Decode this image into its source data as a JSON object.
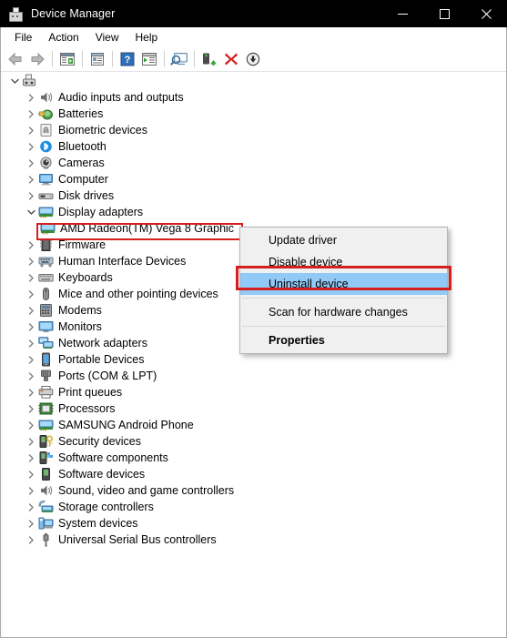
{
  "window": {
    "title": "Device Manager",
    "icon": "device-manager-icon",
    "controls": {
      "minimize": "minimize-icon",
      "maximize": "maximize-icon",
      "close": "close-icon"
    }
  },
  "menubar": {
    "items": [
      {
        "label": "File"
      },
      {
        "label": "Action"
      },
      {
        "label": "View"
      },
      {
        "label": "Help"
      }
    ]
  },
  "toolbar": {
    "buttons": [
      {
        "name": "back-button",
        "icon": "back-arrow-icon"
      },
      {
        "name": "forward-button",
        "icon": "forward-arrow-icon"
      },
      {
        "name": "separator-1",
        "icon": "separator"
      },
      {
        "name": "show-hide-console-tree-button",
        "icon": "console-tree-icon"
      },
      {
        "name": "separator-2",
        "icon": "separator"
      },
      {
        "name": "properties-button",
        "icon": "properties-window-icon"
      },
      {
        "name": "separator-3",
        "icon": "separator"
      },
      {
        "name": "help-button",
        "icon": "help-question-icon"
      },
      {
        "name": "action-button",
        "icon": "action-pane-icon"
      },
      {
        "name": "separator-4",
        "icon": "separator"
      },
      {
        "name": "scan-for-hardware-changes-button",
        "icon": "scan-monitor-icon"
      },
      {
        "name": "separator-5",
        "icon": "separator"
      },
      {
        "name": "update-driver-button",
        "icon": "update-driver-green-icon"
      },
      {
        "name": "uninstall-device-button",
        "icon": "red-x-icon"
      },
      {
        "name": "disable-device-button",
        "icon": "down-arrow-circle-icon"
      }
    ]
  },
  "tree": {
    "root": {
      "label": "",
      "icon": "computer-root-icon",
      "expanded": true
    },
    "nodes": [
      {
        "label": "Audio inputs and outputs",
        "icon": "speaker-icon",
        "expanded": false
      },
      {
        "label": "Batteries",
        "icon": "battery-icon",
        "expanded": false
      },
      {
        "label": "Biometric devices",
        "icon": "fingerprint-icon",
        "expanded": false
      },
      {
        "label": "Bluetooth",
        "icon": "bluetooth-icon",
        "expanded": false
      },
      {
        "label": "Cameras",
        "icon": "camera-icon",
        "expanded": false
      },
      {
        "label": "Computer",
        "icon": "computer-icon",
        "expanded": false
      },
      {
        "label": "Disk drives",
        "icon": "disk-drive-icon",
        "expanded": false
      },
      {
        "label": "Display adapters",
        "icon": "display-adapter-icon",
        "expanded": true
      },
      {
        "label": "AMD Radeon(TM) Vega 8 Graphic",
        "icon": "display-adapter-icon",
        "child": true,
        "selected": true
      },
      {
        "label": "Firmware",
        "icon": "firmware-chip-icon",
        "expanded": false
      },
      {
        "label": "Human Interface Devices",
        "icon": "hid-icon",
        "expanded": false
      },
      {
        "label": "Keyboards",
        "icon": "keyboard-icon",
        "expanded": false
      },
      {
        "label": "Mice and other pointing devices",
        "icon": "mouse-icon",
        "expanded": false
      },
      {
        "label": "Modems",
        "icon": "modem-icon",
        "expanded": false
      },
      {
        "label": "Monitors",
        "icon": "monitor-icon",
        "expanded": false
      },
      {
        "label": "Network adapters",
        "icon": "network-adapter-icon",
        "expanded": false
      },
      {
        "label": "Portable Devices",
        "icon": "portable-device-icon",
        "expanded": false
      },
      {
        "label": "Ports (COM & LPT)",
        "icon": "port-icon",
        "expanded": false
      },
      {
        "label": "Print queues",
        "icon": "printer-icon",
        "expanded": false
      },
      {
        "label": "Processors",
        "icon": "processor-icon",
        "expanded": false
      },
      {
        "label": "SAMSUNG Android Phone",
        "icon": "android-phone-icon",
        "expanded": false
      },
      {
        "label": "Security devices",
        "icon": "security-key-icon",
        "expanded": false
      },
      {
        "label": "Software components",
        "icon": "software-component-icon",
        "expanded": false
      },
      {
        "label": "Software devices",
        "icon": "software-device-icon",
        "expanded": false
      },
      {
        "label": "Sound, video and game controllers",
        "icon": "speaker-icon",
        "expanded": false
      },
      {
        "label": "Storage controllers",
        "icon": "storage-controller-icon",
        "expanded": false
      },
      {
        "label": "System devices",
        "icon": "system-device-icon",
        "expanded": false
      },
      {
        "label": "Universal Serial Bus controllers",
        "icon": "usb-icon",
        "expanded": false
      }
    ]
  },
  "context_menu": {
    "items": [
      {
        "label": "Update driver",
        "selected": false,
        "bold": false
      },
      {
        "label": "Disable device",
        "selected": false,
        "bold": false
      },
      {
        "label": "Uninstall device",
        "selected": true,
        "bold": false
      },
      {
        "label": "Scan for hardware changes",
        "selected": false,
        "bold": false
      },
      {
        "label": "Properties",
        "selected": false,
        "bold": true
      }
    ]
  },
  "annotations": {
    "device_highlight_color": "#d31f1f",
    "menu_highlight_color": "#d31f1f",
    "selection_color": "#91c9f7"
  }
}
